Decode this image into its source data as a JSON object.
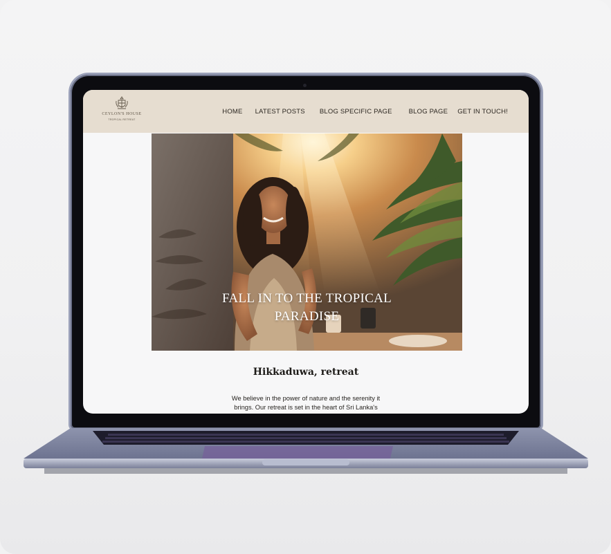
{
  "site": {
    "logo": {
      "title": "CEYLON'S HOUSE",
      "subtitle": "TROPICAL RETREAT"
    },
    "nav": [
      "HOME",
      "LATEST POSTS",
      "BLOG SPECIFIC PAGE",
      "BLOG PAGE",
      "GET IN TOUCH!"
    ],
    "hero": {
      "line1": "FALL IN TO THE TROPICAL",
      "line2": "PARADISE"
    },
    "section": {
      "title": "Hikkaduwa, retreat",
      "body_line1": "We believe in the power of nature and the serenity it",
      "body_line2": "brings. Our retreat is set in the heart of Sri Lanka's"
    }
  },
  "colors": {
    "header_bg": "#e6ddd0",
    "page_bg": "#f7f7f8",
    "text": "#1d1b18",
    "laptop_bezel": "#0c0c10",
    "laptop_body": "#9aa0b8"
  }
}
